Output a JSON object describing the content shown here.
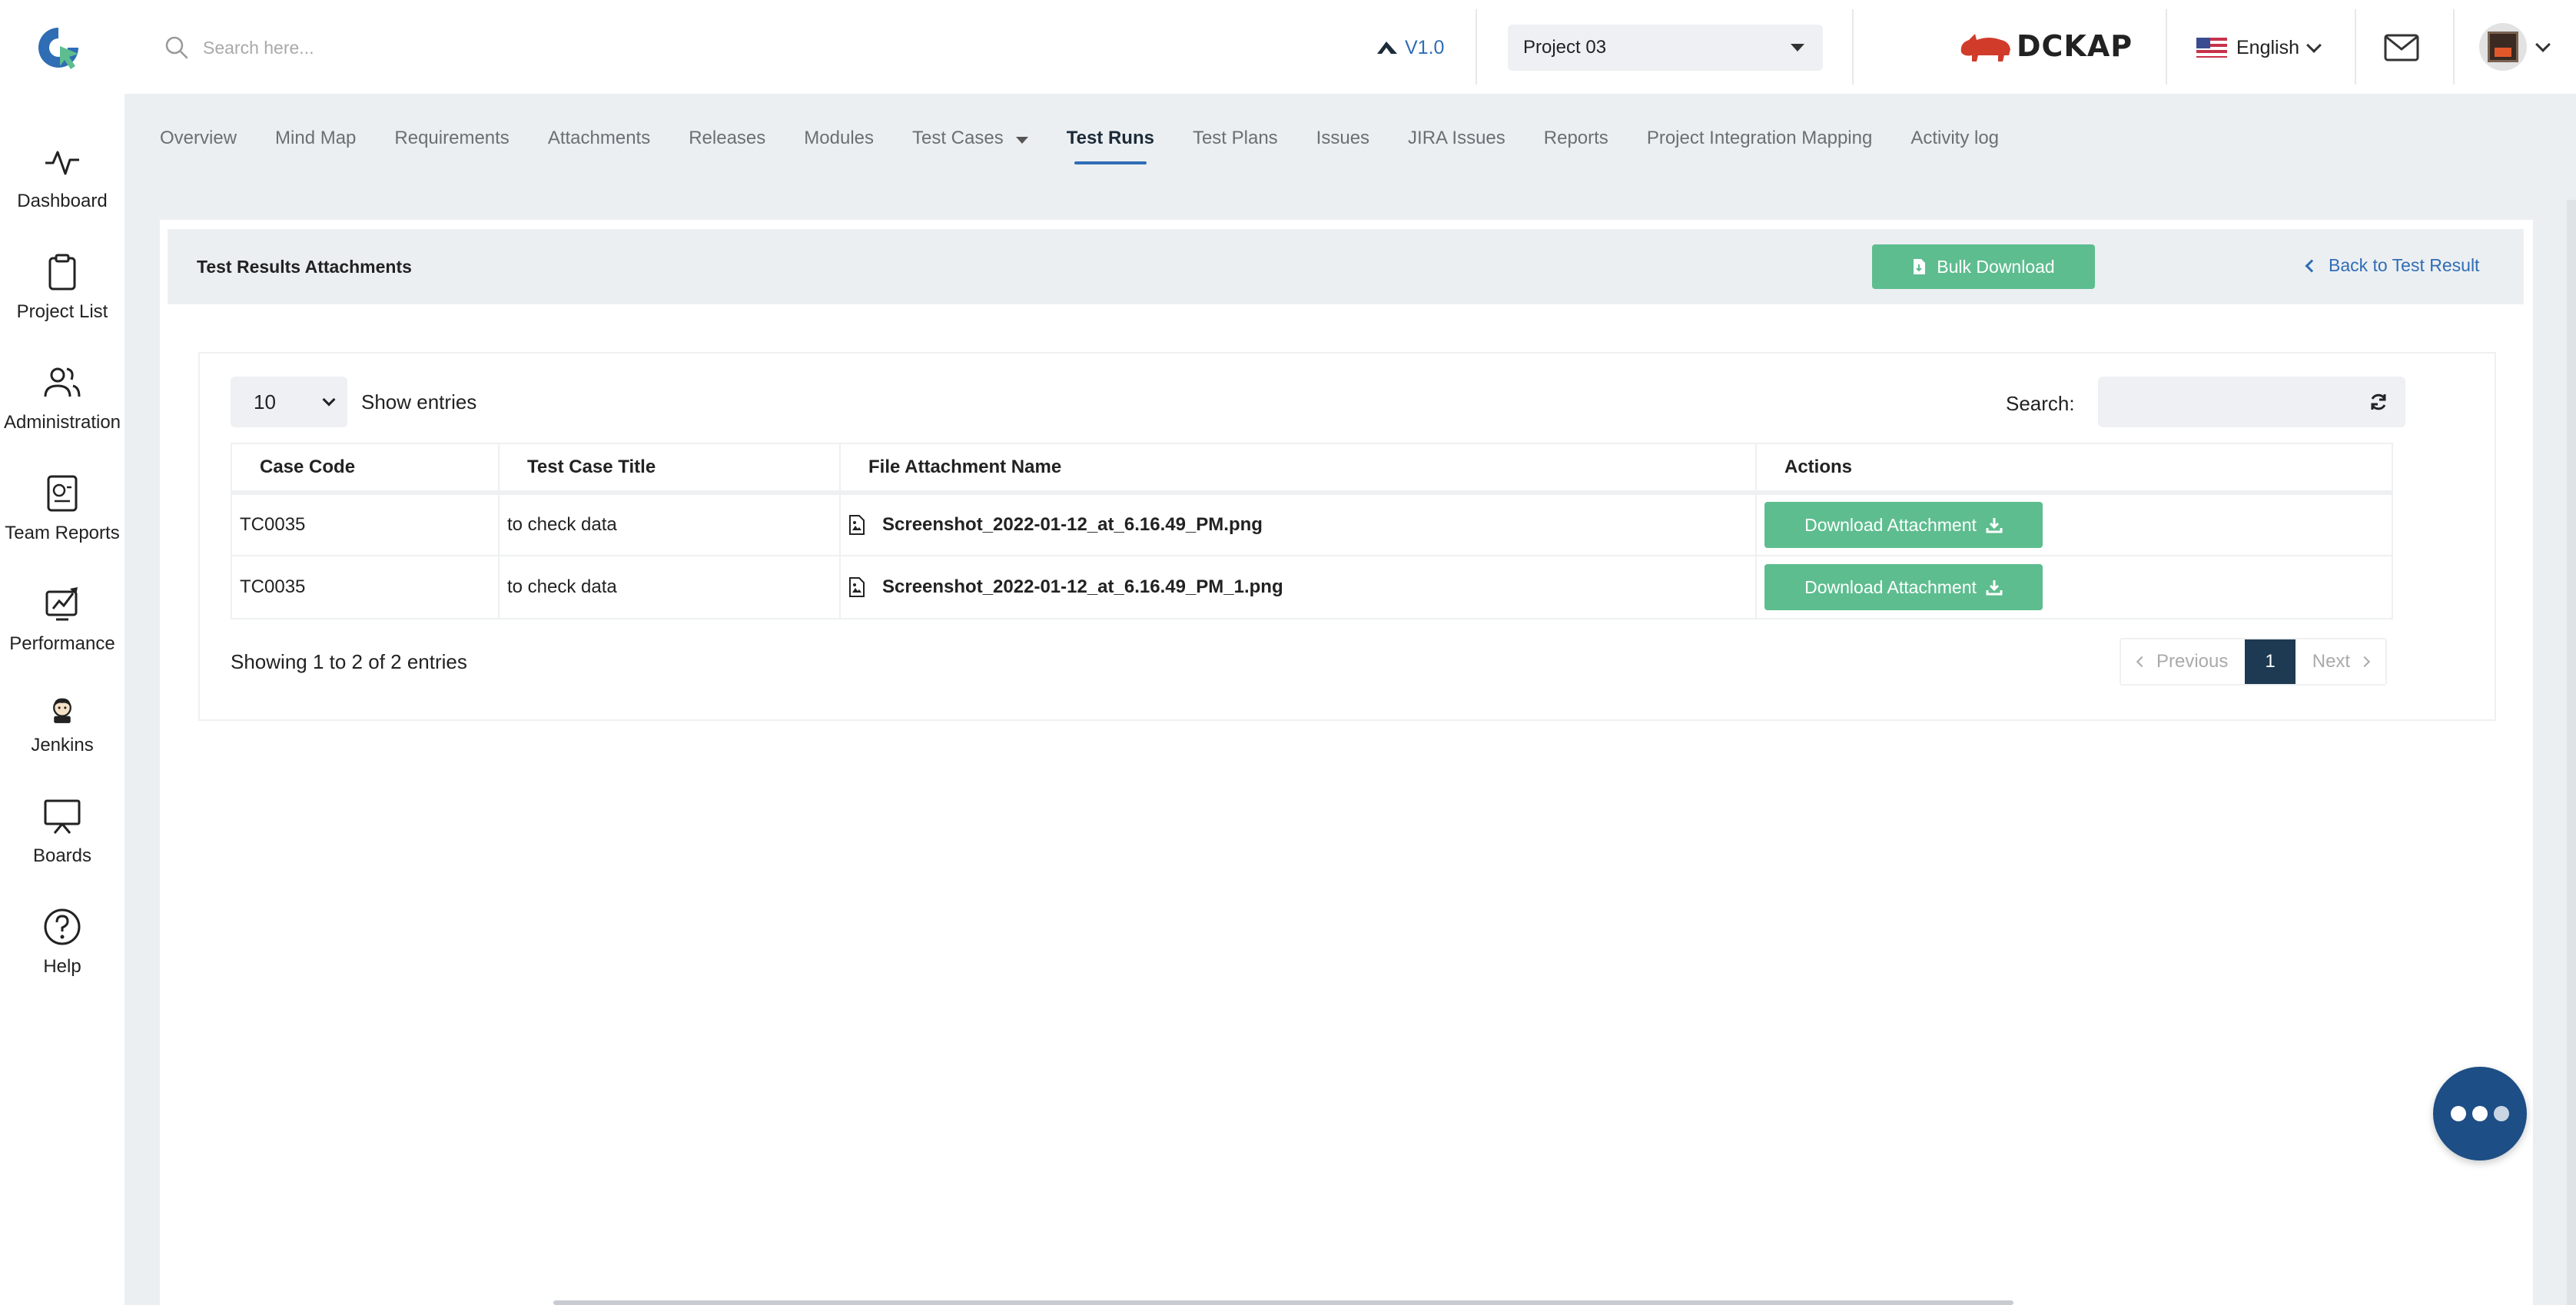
{
  "header": {
    "search_placeholder": "Search here...",
    "version": "V1.0",
    "project": "Project 03",
    "brand": "DCKAP",
    "language": "English"
  },
  "sidebar": {
    "items": [
      {
        "label": "Dashboard",
        "icon": "activity-icon"
      },
      {
        "label": "Project List",
        "icon": "clipboard-icon"
      },
      {
        "label": "Administration",
        "icon": "users-icon"
      },
      {
        "label": "Team Reports",
        "icon": "report-icon"
      },
      {
        "label": "Performance",
        "icon": "performance-icon"
      },
      {
        "label": "Jenkins",
        "icon": "jenkins-icon"
      },
      {
        "label": "Boards",
        "icon": "board-icon"
      },
      {
        "label": "Help",
        "icon": "help-icon"
      }
    ]
  },
  "tabs": [
    {
      "label": "Overview"
    },
    {
      "label": "Mind Map"
    },
    {
      "label": "Requirements"
    },
    {
      "label": "Attachments"
    },
    {
      "label": "Releases"
    },
    {
      "label": "Modules"
    },
    {
      "label": "Test Cases"
    },
    {
      "label": "Test Runs"
    },
    {
      "label": "Test Plans"
    },
    {
      "label": "Issues"
    },
    {
      "label": "JIRA Issues"
    },
    {
      "label": "Reports"
    },
    {
      "label": "Project Integration Mapping"
    },
    {
      "label": "Activity log"
    }
  ],
  "active_tab": "Test Runs",
  "page": {
    "title": "Test Results Attachments",
    "bulk_download": "Bulk Download",
    "back_link": "Back to Test Result"
  },
  "table_controls": {
    "page_length": "10",
    "show_entries": "Show entries",
    "search_label": "Search:"
  },
  "table": {
    "columns": [
      "Case Code",
      "Test Case Title",
      "File Attachment Name",
      "Actions"
    ],
    "rows": [
      {
        "case_code": "TC0035",
        "title": "to check data",
        "file": "Screenshot_2022-01-12_at_6.16.49_PM.png",
        "action": "Download Attachment"
      },
      {
        "case_code": "TC0035",
        "title": "to check data",
        "file": "Screenshot_2022-01-12_at_6.16.49_PM_1.png",
        "action": "Download Attachment"
      }
    ]
  },
  "pagination": {
    "info": "Showing 1 to 2 of 2 entries",
    "previous": "Previous",
    "current": "1",
    "next": "Next"
  },
  "colors": {
    "accent_blue": "#2f6db5",
    "green_button": "#5dbd8f",
    "navy": "#1d3a52",
    "fab": "#1d4e85"
  }
}
